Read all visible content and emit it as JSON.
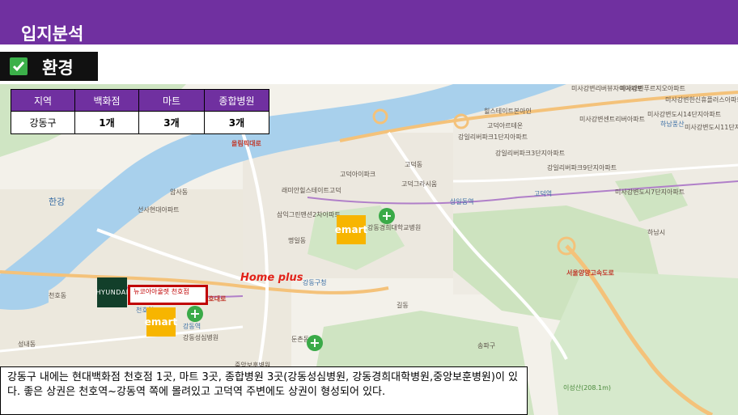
{
  "header": {
    "title": "입지분석"
  },
  "section": {
    "label": "환경",
    "icon": "checkbox-icon"
  },
  "table": {
    "headers": [
      "지역",
      "백화점",
      "마트",
      "종합병원"
    ],
    "rows": [
      [
        "강동구",
        "1개",
        "3개",
        "3개"
      ]
    ]
  },
  "description": "강동구 내에는 현대백화점 천호점 1곳, 마트 3곳, 종합병원 3곳(강동성심병원, 강동경희대학병원,중앙보훈병원)이 있다. 좋은 상권은 천호역~강동역 쪽에 몰려있고 고덕역 주변에도 상권이 형성되어 있다.",
  "map": {
    "poi": {
      "emart": "emart",
      "hyundai": "HYUNDAI",
      "new_core": "뉴코아아울렛 천호점",
      "homeplus": "Home plus",
      "hospital_symbol": "+"
    },
    "labels": [
      {
        "text": "미사강변리버뷰자이아파트"
      },
      {
        "text": "미사강변푸르지오아파트"
      },
      {
        "text": "미사강변한신휴플러스아파트"
      },
      {
        "text": "힐스테이트본아인"
      },
      {
        "text": "미사강변센트리버아파트"
      },
      {
        "text": "미사강변도시14단지아파트"
      },
      {
        "text": "미사강변도시11단지아파트"
      },
      {
        "text": "고덕아르테온"
      },
      {
        "text": "강일리버파크1단지아파트"
      },
      {
        "text": "강일리버파크3단지아파트"
      },
      {
        "text": "강일리버파크9단지아파트"
      },
      {
        "text": "미사강변도시7단지아파트"
      },
      {
        "text": "하남풍산"
      },
      {
        "text": "고덕역"
      },
      {
        "text": "고덕그라시움"
      },
      {
        "text": "래미안힐스테이트고덕"
      },
      {
        "text": "고덕아이파크"
      },
      {
        "text": "삼익그린맨션2차아파트"
      },
      {
        "text": "강동경희대학교병원"
      },
      {
        "text": "암사동"
      },
      {
        "text": "명일동"
      },
      {
        "text": "고덕동"
      },
      {
        "text": "상일동역"
      },
      {
        "text": "강동구청"
      },
      {
        "text": "천호역"
      },
      {
        "text": "강동역"
      },
      {
        "text": "길동"
      },
      {
        "text": "둔촌동"
      },
      {
        "text": "성내동"
      },
      {
        "text": "천호동"
      },
      {
        "text": "송파구"
      },
      {
        "text": "하남시"
      },
      {
        "text": "올림픽대로"
      },
      {
        "text": "천호대로"
      },
      {
        "text": "서울양양고속도로"
      },
      {
        "text": "이성산(208.1m)"
      },
      {
        "text": "중앙보훈병원"
      },
      {
        "text": "강동성심병원"
      },
      {
        "text": "선사현대아파트"
      },
      {
        "text": "한강"
      }
    ]
  }
}
